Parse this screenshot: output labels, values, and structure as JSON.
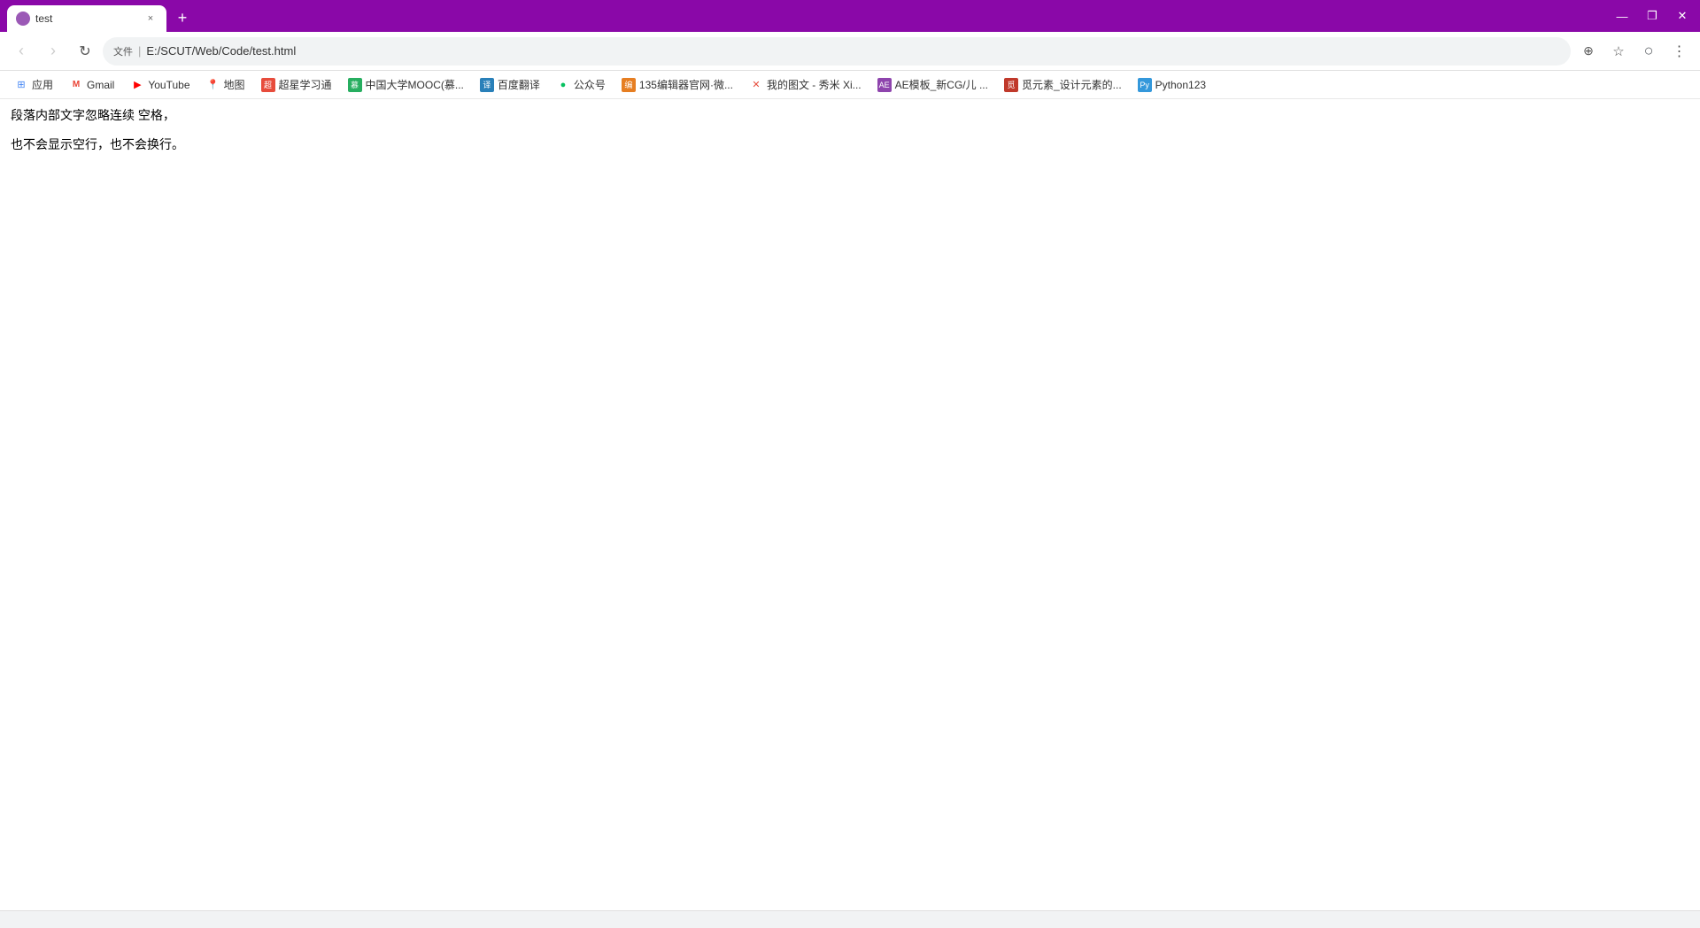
{
  "window": {
    "title": "test"
  },
  "titlebar": {
    "tab_title": "test",
    "new_tab_label": "+"
  },
  "window_controls": {
    "minimize": "—",
    "maximize": "❐",
    "close": "✕"
  },
  "navbar": {
    "url": "E:/SCUT/Web/Code/test.html",
    "secure_label": "文件",
    "back_tooltip": "后退",
    "forward_tooltip": "前进",
    "refresh_tooltip": "刷新",
    "translate_tooltip": "翻译此页"
  },
  "bookmarks": [
    {
      "id": "apps",
      "label": "应用",
      "icon_type": "apps"
    },
    {
      "id": "gmail",
      "label": "Gmail",
      "icon_type": "gmail"
    },
    {
      "id": "youtube",
      "label": "YouTube",
      "icon_type": "youtube"
    },
    {
      "id": "maps",
      "label": "地图",
      "icon_type": "maps"
    },
    {
      "id": "chaoxing",
      "label": "超星学习通",
      "icon_type": "chaoxing"
    },
    {
      "id": "mooc",
      "label": "中国大学MOOC(慕...",
      "icon_type": "mooc"
    },
    {
      "id": "baidu_translate",
      "label": "百度翻译",
      "icon_type": "baidu_translate"
    },
    {
      "id": "gongzhonghao",
      "label": "公众号",
      "icon_type": "gongzhonghao"
    },
    {
      "id": "editor135",
      "label": "135编辑器官网·微...",
      "icon_type": "editor135"
    },
    {
      "id": "xiumi",
      "label": "我的图文 - 秀米 Xi...",
      "icon_type": "xiumi"
    },
    {
      "id": "ae_templates",
      "label": "AE模板_新CG/儿 ...",
      "icon_type": "ae_templates"
    },
    {
      "id": "yuansu",
      "label": "觅元素_设计元素的...",
      "icon_type": "yuansu"
    },
    {
      "id": "python123",
      "label": "Python123",
      "icon_type": "python123"
    }
  ],
  "page": {
    "line1": "段落内部文字忽略连续     空格，",
    "line2": "也不会显示空行，也不会换行。"
  },
  "statusbar": {
    "text": ""
  }
}
